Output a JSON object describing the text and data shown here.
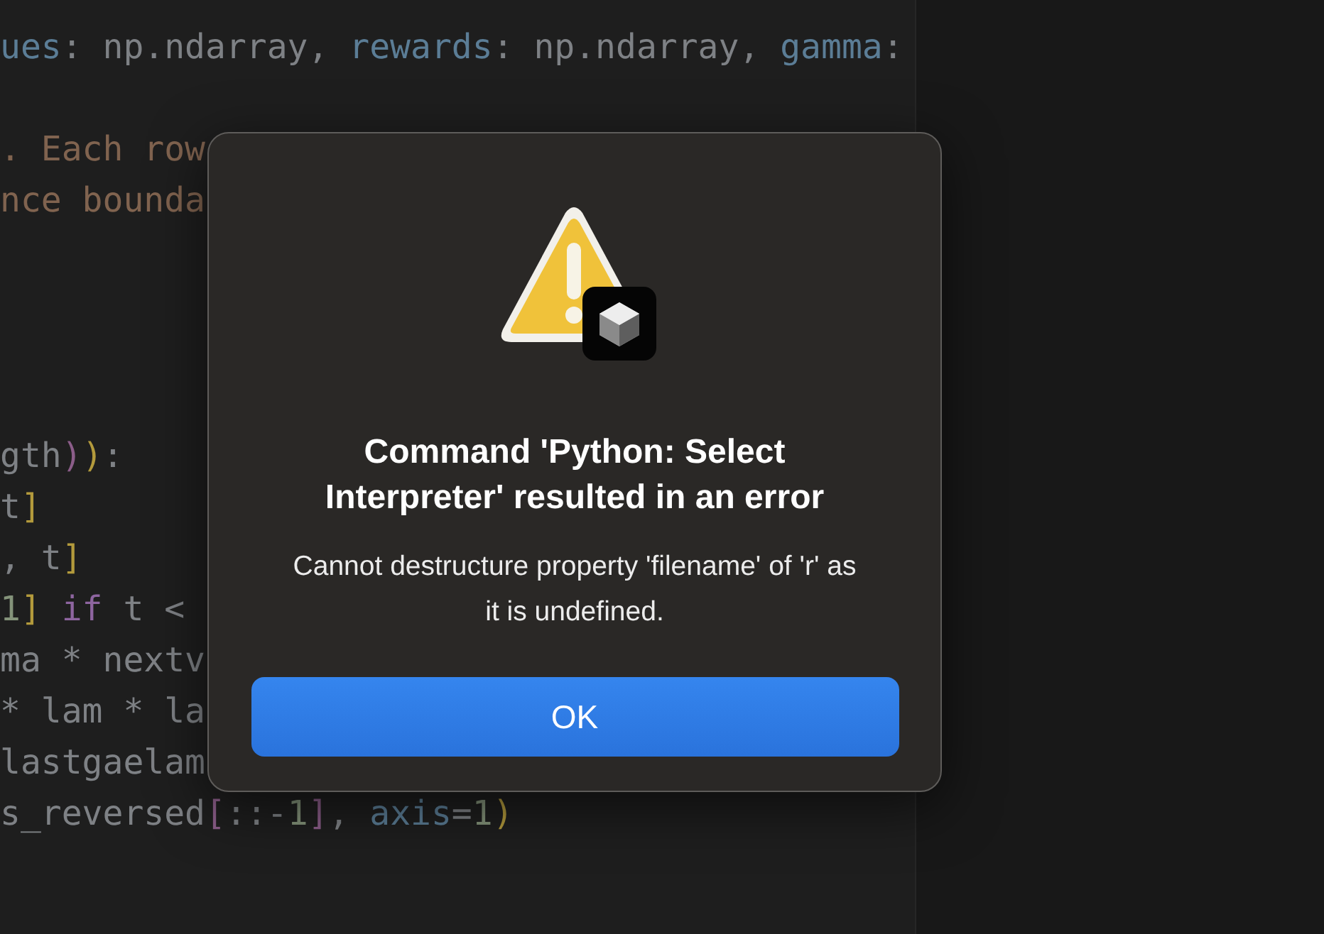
{
  "editor": {
    "lines": [
      {
        "kind": "code",
        "tokens": [
          {
            "kind": "param",
            "text": "ues"
          },
          {
            "kind": "plain",
            "text": ": np.ndarray, "
          },
          {
            "kind": "param",
            "text": "rewards"
          },
          {
            "kind": "plain",
            "text": ": np.ndarray, "
          },
          {
            "kind": "param",
            "text": "gamma"
          },
          {
            "kind": "plain",
            "text": ":"
          }
        ]
      },
      {
        "kind": "blank"
      },
      {
        "kind": "code",
        "tokens": [
          {
            "kind": "string",
            "text": ". Each row"
          }
        ]
      },
      {
        "kind": "code",
        "tokens": [
          {
            "kind": "string",
            "text": "nce bounda"
          }
        ]
      },
      {
        "kind": "blank"
      },
      {
        "kind": "blank"
      },
      {
        "kind": "blank"
      },
      {
        "kind": "blank"
      },
      {
        "kind": "code",
        "tokens": [
          {
            "kind": "plain",
            "text": "gth"
          },
          {
            "kind": "bracket2",
            "text": ")"
          },
          {
            "kind": "bracket",
            "text": ")"
          },
          {
            "kind": "plain",
            "text": ":"
          }
        ]
      },
      {
        "kind": "code",
        "tokens": [
          {
            "kind": "plain",
            "text": "t"
          },
          {
            "kind": "bracket",
            "text": "]"
          }
        ]
      },
      {
        "kind": "code",
        "tokens": [
          {
            "kind": "plain",
            "text": ", t"
          },
          {
            "kind": "bracket",
            "text": "]"
          }
        ]
      },
      {
        "kind": "code",
        "tokens": [
          {
            "kind": "number",
            "text": "1"
          },
          {
            "kind": "bracket",
            "text": "] "
          },
          {
            "kind": "keyword",
            "text": "if"
          },
          {
            "kind": "plain",
            "text": " t <"
          }
        ]
      },
      {
        "kind": "code",
        "tokens": [
          {
            "kind": "plain",
            "text": "ma * nextv"
          }
        ]
      },
      {
        "kind": "code",
        "tokens": [
          {
            "kind": "plain",
            "text": "* lam * la"
          }
        ]
      },
      {
        "kind": "code",
        "tokens": [
          {
            "kind": "plain",
            "text": "lastgaelam"
          }
        ]
      },
      {
        "kind": "code",
        "tokens": [
          {
            "kind": "plain",
            "text": "s_reversed"
          },
          {
            "kind": "bracket2",
            "text": "["
          },
          {
            "kind": "plain",
            "text": "::-"
          },
          {
            "kind": "number",
            "text": "1"
          },
          {
            "kind": "bracket2",
            "text": "]"
          },
          {
            "kind": "plain",
            "text": ", "
          },
          {
            "kind": "param",
            "text": "axis"
          },
          {
            "kind": "plain",
            "text": "="
          },
          {
            "kind": "number",
            "text": "1"
          },
          {
            "kind": "bracket",
            "text": ")"
          }
        ]
      }
    ]
  },
  "dialog": {
    "title": "Command 'Python: Select Interpreter' resulted in an error",
    "message": "Cannot destructure property 'filename' of 'r' as it is undefined.",
    "buttons": [
      "OK"
    ]
  }
}
